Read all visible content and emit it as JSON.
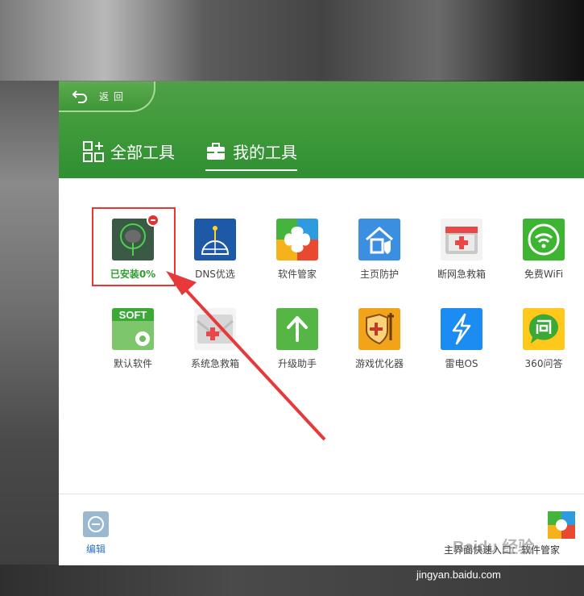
{
  "header": {
    "back_label": "返回",
    "tabs": [
      {
        "label": "全部工具",
        "active": false
      },
      {
        "label": "我的工具",
        "active": true
      }
    ]
  },
  "tools": [
    {
      "label": "已安装0%",
      "icon": "installing-tool-icon",
      "status": "installing"
    },
    {
      "label": "DNS优选",
      "icon": "dns-globe-icon"
    },
    {
      "label": "软件管家",
      "icon": "software-manager-icon"
    },
    {
      "label": "主页防护",
      "icon": "home-shield-icon"
    },
    {
      "label": "断网急救箱",
      "icon": "first-aid-kit-icon"
    },
    {
      "label": "免费WiFi",
      "icon": "wifi-icon"
    },
    {
      "label": "默认软件",
      "icon": "soft-gear-icon"
    },
    {
      "label": "系统急救箱",
      "icon": "system-rescue-icon"
    },
    {
      "label": "升级助手",
      "icon": "upgrade-arrow-icon"
    },
    {
      "label": "游戏优化器",
      "icon": "game-shield-icon"
    },
    {
      "label": "雷电OS",
      "icon": "lightning-icon"
    },
    {
      "label": "360问答",
      "icon": "qa-bubble-icon"
    }
  ],
  "footer": {
    "edit_label": "编辑",
    "desktop_shortcut_label": "主界面快速入口：软件管家"
  },
  "watermark": {
    "text": "jingyan.baidu.com",
    "logo": "Baidu 经验"
  },
  "colors": {
    "header_green": "#3f9a3a",
    "highlight_red": "#e33333",
    "installing_green": "#2ea02e",
    "edit_blue": "#2a74c9"
  }
}
